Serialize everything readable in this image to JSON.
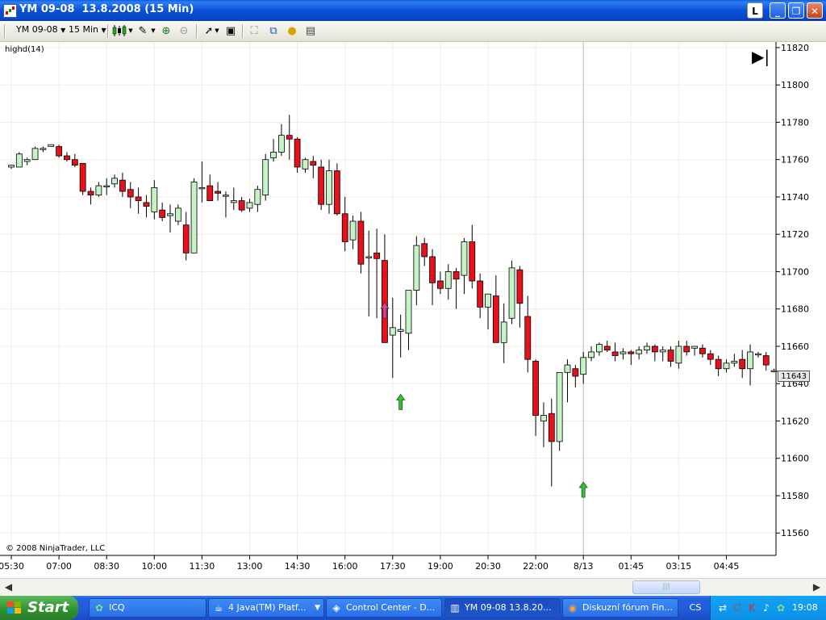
{
  "window": {
    "title": "YM 09-08  13.8.2008 (15 Min)",
    "buttons": {
      "l": "L",
      "minimize": "_",
      "restore": "❐",
      "close": "✕"
    }
  },
  "toolbar": {
    "instrument": "YM 09-08",
    "interval": "15 Min",
    "icons": [
      "bar-type-icon",
      "pencil-icon",
      "zoom-in-icon",
      "zoom-out-icon",
      "cursor-icon",
      "properties-icon",
      "drawing-icon",
      "indicators-icon",
      "strategies-icon",
      "data-box-icon"
    ]
  },
  "chart": {
    "indicator_label": "highd(14)",
    "copyright": "© 2008 NinjaTrader, LLC",
    "current_price_label": "11643",
    "colors": {
      "up": "#c6f2c6",
      "down": "#e8101a",
      "arrow_up": "#22cc22",
      "arrow_magenta": "#e040a0"
    }
  },
  "chart_data": {
    "type": "candlestick",
    "y_range": [
      11548,
      11823
    ],
    "y_ticks": [
      "11820",
      "11800",
      "11780",
      "11760",
      "11740",
      "11720",
      "11700",
      "11680",
      "11660",
      "11640",
      "11620",
      "11600",
      "11580",
      "11560"
    ],
    "x_ticks": [
      "05:30",
      "07:00",
      "08:30",
      "10:00",
      "11:30",
      "13:00",
      "14:30",
      "16:00",
      "17:30",
      "19:00",
      "20:30",
      "22:00",
      "8/13",
      "01:45",
      "03:15",
      "04:45"
    ],
    "candles": [
      [
        11756,
        11757,
        11755,
        11757
      ],
      [
        11756,
        11764,
        11756,
        11763
      ],
      [
        11759,
        11761,
        11757,
        11760
      ],
      [
        11760,
        11767,
        11760,
        11766
      ],
      [
        11766,
        11767,
        11764,
        11766
      ],
      [
        11767,
        11768,
        11767,
        11768
      ],
      [
        11767,
        11768,
        11761,
        11762
      ],
      [
        11762,
        11764,
        11759,
        11760
      ],
      [
        11760,
        11763,
        11756,
        11757
      ],
      [
        11758,
        11758,
        11741,
        11743
      ],
      [
        11743,
        11745,
        11736,
        11741
      ],
      [
        11741,
        11748,
        11740,
        11746
      ],
      [
        11746,
        11750,
        11741,
        11746
      ],
      [
        11747,
        11752,
        11745,
        11750
      ],
      [
        11749,
        11753,
        11740,
        11743
      ],
      [
        11744,
        11748,
        11734,
        11740
      ],
      [
        11740,
        11745,
        11731,
        11738
      ],
      [
        11737,
        11741,
        11729,
        11735
      ],
      [
        11732,
        11749,
        11728,
        11745
      ],
      [
        11733,
        11737,
        11727,
        11729
      ],
      [
        11730,
        11736,
        11721,
        11731
      ],
      [
        11727,
        11736,
        11725,
        11734
      ],
      [
        11725,
        11732,
        11706,
        11710
      ],
      [
        11710,
        11750,
        11710,
        11748
      ],
      [
        11745,
        11759,
        11737,
        11745
      ],
      [
        11746,
        11752,
        11739,
        11738
      ],
      [
        11743,
        11748,
        11738,
        11742
      ],
      [
        11741,
        11743,
        11729,
        11741
      ],
      [
        11737,
        11745,
        11733,
        11738
      ],
      [
        11738,
        11740,
        11732,
        11733
      ],
      [
        11734,
        11739,
        11732,
        11737
      ],
      [
        11736,
        11746,
        11732,
        11744
      ],
      [
        11741,
        11763,
        11738,
        11760
      ],
      [
        11761,
        11771,
        11759,
        11764
      ],
      [
        11764,
        11779,
        11762,
        11773
      ],
      [
        11773,
        11784,
        11760,
        11771
      ],
      [
        11771,
        11772,
        11753,
        11756
      ],
      [
        11755,
        11761,
        11753,
        11760
      ],
      [
        11759,
        11762,
        11750,
        11757
      ],
      [
        11756,
        11760,
        11733,
        11736
      ],
      [
        11736,
        11760,
        11731,
        11754
      ],
      [
        11754,
        11758,
        11730,
        11731
      ],
      [
        11731,
        11740,
        11711,
        11716
      ],
      [
        11717,
        11730,
        11712,
        11727
      ],
      [
        11727,
        11732,
        11699,
        11704
      ],
      [
        11708,
        11722,
        11676,
        11708
      ],
      [
        11710,
        11723,
        11675,
        11707
      ],
      [
        11706,
        11720,
        11663,
        11662
      ],
      [
        11666,
        11686,
        11643,
        11670
      ],
      [
        11668,
        11677,
        11654,
        11669
      ],
      [
        11667,
        11690,
        11658,
        11690
      ],
      [
        11690,
        11719,
        11682,
        11714
      ],
      [
        11715,
        11718,
        11703,
        11708
      ],
      [
        11708,
        11712,
        11682,
        11694
      ],
      [
        11695,
        11700,
        11688,
        11691
      ],
      [
        11691,
        11704,
        11685,
        11700
      ],
      [
        11700,
        11702,
        11680,
        11696
      ],
      [
        11698,
        11718,
        11688,
        11716
      ],
      [
        11716,
        11725,
        11691,
        11695
      ],
      [
        11695,
        11699,
        11675,
        11681
      ],
      [
        11681,
        11685,
        11669,
        11688
      ],
      [
        11687,
        11698,
        11671,
        11662
      ],
      [
        11662,
        11683,
        11651,
        11673
      ],
      [
        11675,
        11706,
        11672,
        11702
      ],
      [
        11701,
        11703,
        11670,
        11683
      ],
      [
        11676,
        11687,
        11646,
        11653
      ],
      [
        11652,
        11653,
        11612,
        11623
      ],
      [
        11620,
        11630,
        11606,
        11623
      ],
      [
        11624,
        11632,
        11585,
        11609
      ],
      [
        11609,
        11644,
        11604,
        11646
      ],
      [
        11646,
        11653,
        11630,
        11650
      ],
      [
        11648,
        11650,
        11638,
        11644
      ],
      [
        11645,
        11657,
        11640,
        11654
      ],
      [
        11654,
        11660,
        11652,
        11657
      ],
      [
        11657,
        11662,
        11655,
        11661
      ],
      [
        11660,
        11663,
        11657,
        11658
      ],
      [
        11657,
        11662,
        11652,
        11655
      ],
      [
        11656,
        11659,
        11653,
        11657
      ],
      [
        11657,
        11658,
        11650,
        11656
      ],
      [
        11656,
        11660,
        11653,
        11658
      ],
      [
        11658,
        11662,
        11656,
        11660
      ],
      [
        11660,
        11661,
        11652,
        11657
      ],
      [
        11657,
        11660,
        11652,
        11658
      ],
      [
        11658,
        11660,
        11649,
        11652
      ],
      [
        11651,
        11663,
        11648,
        11660
      ],
      [
        11660,
        11663,
        11655,
        11657
      ],
      [
        11659,
        11660,
        11655,
        11660
      ],
      [
        11659,
        11661,
        11654,
        11656
      ],
      [
        11656,
        11658,
        11650,
        11653
      ],
      [
        11653,
        11655,
        11644,
        11648
      ],
      [
        11648,
        11653,
        11646,
        11651
      ],
      [
        11651,
        11656,
        11649,
        11652
      ],
      [
        11653,
        11658,
        11643,
        11648
      ],
      [
        11648,
        11661,
        11639,
        11657
      ],
      [
        11656,
        11657,
        11654,
        11656
      ],
      [
        11655,
        11657,
        11647,
        11650
      ],
      [
        11647,
        11648,
        11646,
        11647
      ],
      [
        11643,
        11644,
        11643,
        11643
      ]
    ],
    "signals": [
      {
        "type": "up",
        "color": "magenta",
        "time_index": 47,
        "price": 11679
      },
      {
        "type": "up",
        "color": "green",
        "time_index": 49,
        "price": 11630
      },
      {
        "type": "up",
        "color": "green",
        "time_index": 72,
        "price": 11583
      }
    ],
    "session_break": "8/13",
    "grid": true
  },
  "scrollbar": {
    "left_arrow": "◀",
    "right_arrow": "▶",
    "thumb_grip": "|||"
  },
  "taskbar": {
    "start_label": "Start",
    "tasks": [
      {
        "label": "ICQ",
        "icon": "icq-flower-icon",
        "active": false
      },
      {
        "label": "4 Java(TM) Platf...",
        "icon": "java-icon",
        "active": false
      },
      {
        "label": "Control Center - D...",
        "icon": "control-center-icon",
        "active": false
      },
      {
        "label": "YM 09-08  13.8.20...",
        "icon": "chart-icon",
        "active": true
      },
      {
        "label": "Diskuzní fórum Fin...",
        "icon": "firefox-icon",
        "active": false
      }
    ],
    "language": "CS",
    "clock": "19:08"
  }
}
